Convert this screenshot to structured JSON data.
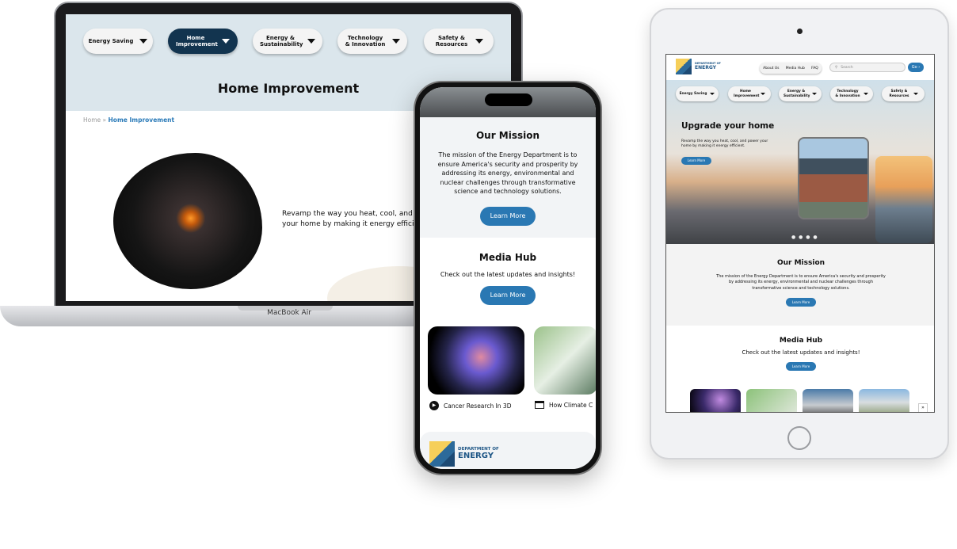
{
  "laptop": {
    "label": "MacBook Air",
    "nav": [
      "Energy Saving",
      "Home Improvement",
      "Energy & Sustainability",
      "Technology & Innovation",
      "Safety & Resources"
    ],
    "active_nav": "Home Improvement",
    "title": "Home Improvement",
    "breadcrumb": {
      "home": "Home",
      "separator": "»",
      "current": "Home Improvement"
    },
    "body_text": "Revamp the way you heat, cool, and power your home by making it energy efficient."
  },
  "phone": {
    "mission": {
      "title": "Our Mission",
      "text": "The mission of the Energy Department is to ensure America's security and prosperity by addressing its energy, environmental and nuclear challenges through transformative science and technology solutions.",
      "button": "Learn More"
    },
    "media": {
      "title": "Media Hub",
      "text": "Check out the latest updates and insights!",
      "button": "Learn More",
      "cards": [
        {
          "caption": "Cancer Research In 3D",
          "icon": "play-icon"
        },
        {
          "caption": "How Climate C",
          "icon": "article-icon"
        }
      ]
    },
    "footer_logo": {
      "line1": "DEPARTMENT OF",
      "line2": "ENERGY"
    }
  },
  "tablet": {
    "logo": {
      "line1": "DEPARTMENT OF",
      "line2": "ENERGY"
    },
    "links": [
      "About Us",
      "Media Hub",
      "FAQ"
    ],
    "search_placeholder": "Search",
    "go_label": "Go ›",
    "nav": [
      "Energy Saving",
      "Home Improvement",
      "Energy & Sustainability",
      "Technology & Innovation",
      "Safety & Resources"
    ],
    "hero": {
      "title": "Upgrade your home",
      "text": "Revamp the way you heat, cool, and power your home by making it energy efficient.",
      "button": "Learn More",
      "dots": "● ● ● ●"
    },
    "mission": {
      "title": "Our Mission",
      "text": "The mission of the Energy Department is to ensure America's security and prosperity by addressing its energy, environmental and nuclear challenges through transformative science and technology solutions.",
      "button": "Learn More"
    },
    "media": {
      "title": "Media Hub",
      "text": "Check out the latest updates and insights!",
      "button": "Learn More",
      "next": "»"
    }
  }
}
